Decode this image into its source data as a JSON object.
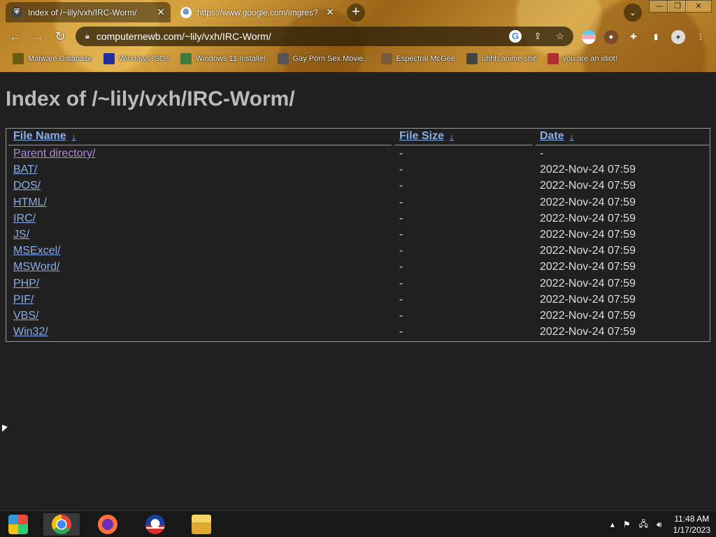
{
  "browser": {
    "tabs": [
      {
        "title": "Index of /~lily/vxh/IRC-Worm/",
        "favicon": "shield-icon",
        "active": true
      },
      {
        "title": "https://www.google.com/imgres?",
        "favicon": "google-icon",
        "active": false
      }
    ],
    "new_tab_symbol": "+",
    "tab_search_symbol": "⌄",
    "window_controls": {
      "minimize": "—",
      "restore": "❐",
      "close": "✕"
    },
    "url": "computernewb.com/~lily/vxh/IRC-Worm/",
    "bookmarks": [
      {
        "label": "Malware Database",
        "icon": "biohazard-icon",
        "color": "#6b5a12"
      },
      {
        "label": "Windows ISOs",
        "icon": "x-logo-icon",
        "color": "#1e2fa0"
      },
      {
        "label": "Windows 11 Installer",
        "icon": "image-icon",
        "color": "#3d7a3d"
      },
      {
        "label": "Gay Porn Sex Movie...",
        "icon": "globe-icon",
        "color": "#555555"
      },
      {
        "label": "Espectral McGee",
        "icon": "face-icon",
        "color": "#7a5a3a"
      },
      {
        "label": "uhhh anime shit",
        "icon": "anime-icon",
        "color": "#444444"
      },
      {
        "label": "you are an idiot!",
        "icon": "flag-icon",
        "color": "#b03030"
      }
    ]
  },
  "page": {
    "title": "Index of /~lily/vxh/IRC-Worm/",
    "headers": {
      "name": "File Name",
      "size": "File Size",
      "date": "Date",
      "sort_arrow": "↓"
    },
    "rows": [
      {
        "name": "Parent directory/",
        "size": "-",
        "date": "-"
      },
      {
        "name": "BAT/",
        "size": "-",
        "date": "2022-Nov-24 07:59"
      },
      {
        "name": "DOS/",
        "size": "-",
        "date": "2022-Nov-24 07:59"
      },
      {
        "name": "HTML/",
        "size": "-",
        "date": "2022-Nov-24 07:59"
      },
      {
        "name": "IRC/",
        "size": "-",
        "date": "2022-Nov-24 07:59"
      },
      {
        "name": "JS/",
        "size": "-",
        "date": "2022-Nov-24 07:59"
      },
      {
        "name": "MSExcel/",
        "size": "-",
        "date": "2022-Nov-24 07:59"
      },
      {
        "name": "MSWord/",
        "size": "-",
        "date": "2022-Nov-24 07:59"
      },
      {
        "name": "PHP/",
        "size": "-",
        "date": "2022-Nov-24 07:59"
      },
      {
        "name": "PIF/",
        "size": "-",
        "date": "2022-Nov-24 07:59"
      },
      {
        "name": "VBS/",
        "size": "-",
        "date": "2022-Nov-24 07:59"
      },
      {
        "name": "Win32/",
        "size": "-",
        "date": "2022-Nov-24 07:59"
      }
    ]
  },
  "taskbar": {
    "items": [
      "start-orb-icon",
      "chrome-icon",
      "firefox-icon",
      "obama-logo-icon",
      "file-explorer-icon"
    ],
    "clock_time": "11:48 AM",
    "clock_date": "1/17/2023"
  }
}
